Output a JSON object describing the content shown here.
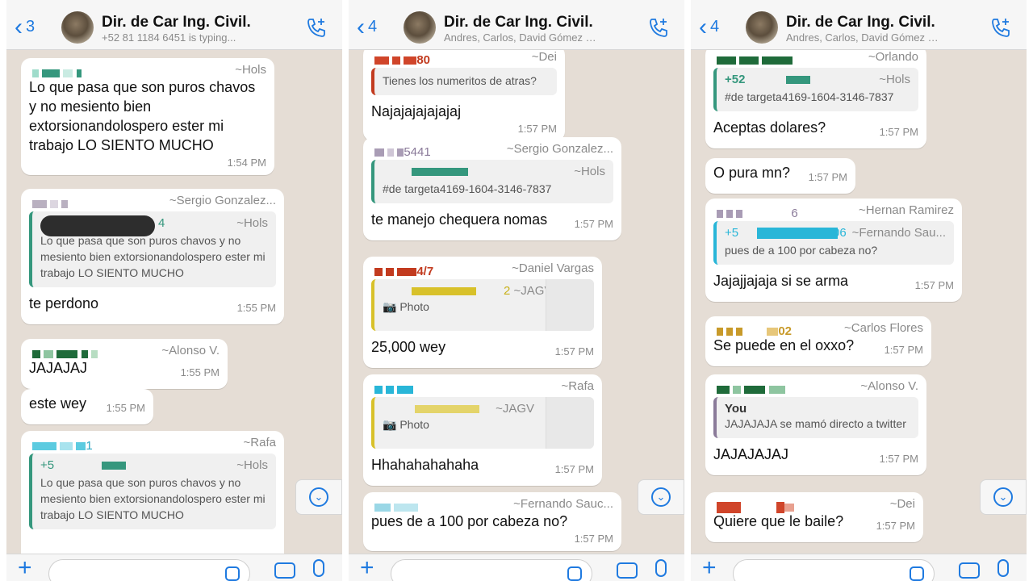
{
  "colors": {
    "accent": "#1f7ae0",
    "quote_bar_green": "#35977d",
    "quote_bar_yellow": "#d8c12a",
    "bubble": "#ffffff",
    "wallpaper": "#e5ddd5"
  },
  "screens": [
    {
      "header": {
        "back_count": "3",
        "title": "Dir. de Car Ing. Civil.",
        "subtitle": "+52 81 1184 6451 is typing..."
      },
      "messages": [
        {
          "author": "~Hols",
          "text": "Lo que pasa que son puros chavos y no mesiento bien extorsionandolospero ester mi trabajo LO SIENTO MUCHO",
          "time": "1:54 PM"
        },
        {
          "author": "~Sergio Gonzalez...",
          "quote_author_suffix": "4",
          "quote_author": "~Hols",
          "quote_text": "Lo que pasa que son puros chavos y no mesiento bien extorsionandolospero ester mi trabajo LO SIENTO MUCHO",
          "text": "te perdono",
          "time": "1:55 PM"
        },
        {
          "author": "~Alonso V.",
          "text": "JAJAJAJ",
          "time": "1:55 PM"
        },
        {
          "text": "este wey",
          "time": "1:55 PM"
        },
        {
          "author": "~Rafa",
          "author_suffix": "1",
          "quote_author_prefix": "+5",
          "quote_author": "~Hols",
          "quote_text": "Lo que pasa que son puros chavos y no mesiento bien extorsionandolospero ester mi trabajo LO SIENTO MUCHO"
        }
      ]
    },
    {
      "header": {
        "back_count": "4",
        "title": "Dir. de Car Ing. Civil.",
        "subtitle": "Andres, Carlos, David Gómez M, Del..."
      },
      "messages": [
        {
          "author": "~Dei",
          "author_suffix": "80",
          "quote_text": "Tienes los numeritos de atras?",
          "text": "Najajajajajajaj",
          "time": "1:57 PM"
        },
        {
          "author": "~Sergio Gonzalez...",
          "author_suffix": "5441",
          "quote_author": "~Hols",
          "quote_text": "#de targeta4169-1604-3146-7837",
          "text": "te manejo chequera nomas",
          "time": "1:57 PM"
        },
        {
          "author": "~Daniel Vargas",
          "author_suffix": "4/7",
          "quote_author": "~JAGV",
          "quote_author_suffix": "2",
          "quote_text": "Photo",
          "text": "25,000 wey",
          "time": "1:57 PM"
        },
        {
          "author": "~Rafa",
          "quote_author": "~JAGV",
          "quote_text": "Photo",
          "text": "Hhahahahahaha",
          "time": "1:57 PM"
        },
        {
          "author": "~Fernando Sauc...",
          "text": "pues de a 100 por cabeza no?",
          "time": "1:57 PM"
        }
      ]
    },
    {
      "header": {
        "back_count": "4",
        "title": "Dir. de Car Ing. Civil.",
        "subtitle": "Andres, Carlos, David Gómez M, Del..."
      },
      "messages": [
        {
          "author": "~Orlando",
          "quote_author_prefix": "+52",
          "quote_author": "~Hols",
          "quote_text": "#de targeta4169-1604-3146-7837",
          "text": "Aceptas dolares?",
          "time": "1:57 PM"
        },
        {
          "text": "O pura mn?",
          "time": "1:57 PM"
        },
        {
          "author": "~Hernan Ramirez",
          "author_suffix": "6",
          "quote_author_prefix": "+5",
          "quote_author_suffix": "06",
          "quote_author": "~Fernando Sau...",
          "quote_text": "pues de a 100 por cabeza no?",
          "text": "Jajajjajaja si se arma",
          "time": "1:57 PM"
        },
        {
          "author": "~Carlos Flores",
          "author_suffix": "02",
          "text": "Se puede en el oxxo?",
          "time": "1:57 PM"
        },
        {
          "author": "~Alonso V.",
          "quote_author": "You",
          "quote_text": "JAJAJAJA se mamó directo a twitter",
          "text": "JAJAJAJAJ",
          "time": "1:57 PM"
        },
        {
          "author": "~Dei",
          "text": "Quiere que le baile?",
          "time": "1:57 PM"
        }
      ]
    }
  ]
}
